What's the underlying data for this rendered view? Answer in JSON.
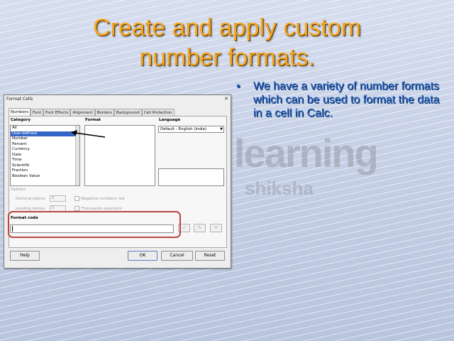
{
  "slide": {
    "title_line1": "Create and apply custom",
    "title_line2": "number formats.",
    "bullet_symbol": "•",
    "bullet_text": "We have a variety of number formats which can be used to format the data in a cell in Calc."
  },
  "dialog": {
    "title": "Format Cells",
    "close_glyph": "✕",
    "tabs": [
      "Numbers",
      "Font",
      "Font Effects",
      "Alignment",
      "Borders",
      "Background",
      "Cell Protection"
    ],
    "category_label": "Category",
    "categories": [
      "All",
      "User-defined",
      "Number",
      "Percent",
      "Currency",
      "Date",
      "Time",
      "Scientific",
      "Fraction",
      "Boolean Value"
    ],
    "selected_category_index": 1,
    "format_label": "Format",
    "language_label": "Language",
    "language_value": "Default - English (India)",
    "options_label": "Options",
    "decimal_places_label": "Decimal places",
    "decimal_places_value": "0",
    "leading_zeroes_label": "Leading zeroes",
    "leading_zeroes_value": "0",
    "negative_red_label": "Negative numbers red",
    "thousands_sep_label": "Thousands separator",
    "format_code_label": "Format code",
    "format_code_value": "",
    "icon_buttons": [
      "✓",
      "✎",
      "✕"
    ],
    "help_label": "Help",
    "ok_label": "OK",
    "cancel_label": "Cancel",
    "reset_label": "Reset"
  },
  "watermark": {
    "line1": "learning",
    "line2": "shiksha"
  },
  "colors": {
    "title": "#f5a623",
    "bullet": "#1f5fbf",
    "highlight": "#b9473e",
    "selection": "#3466c8"
  }
}
